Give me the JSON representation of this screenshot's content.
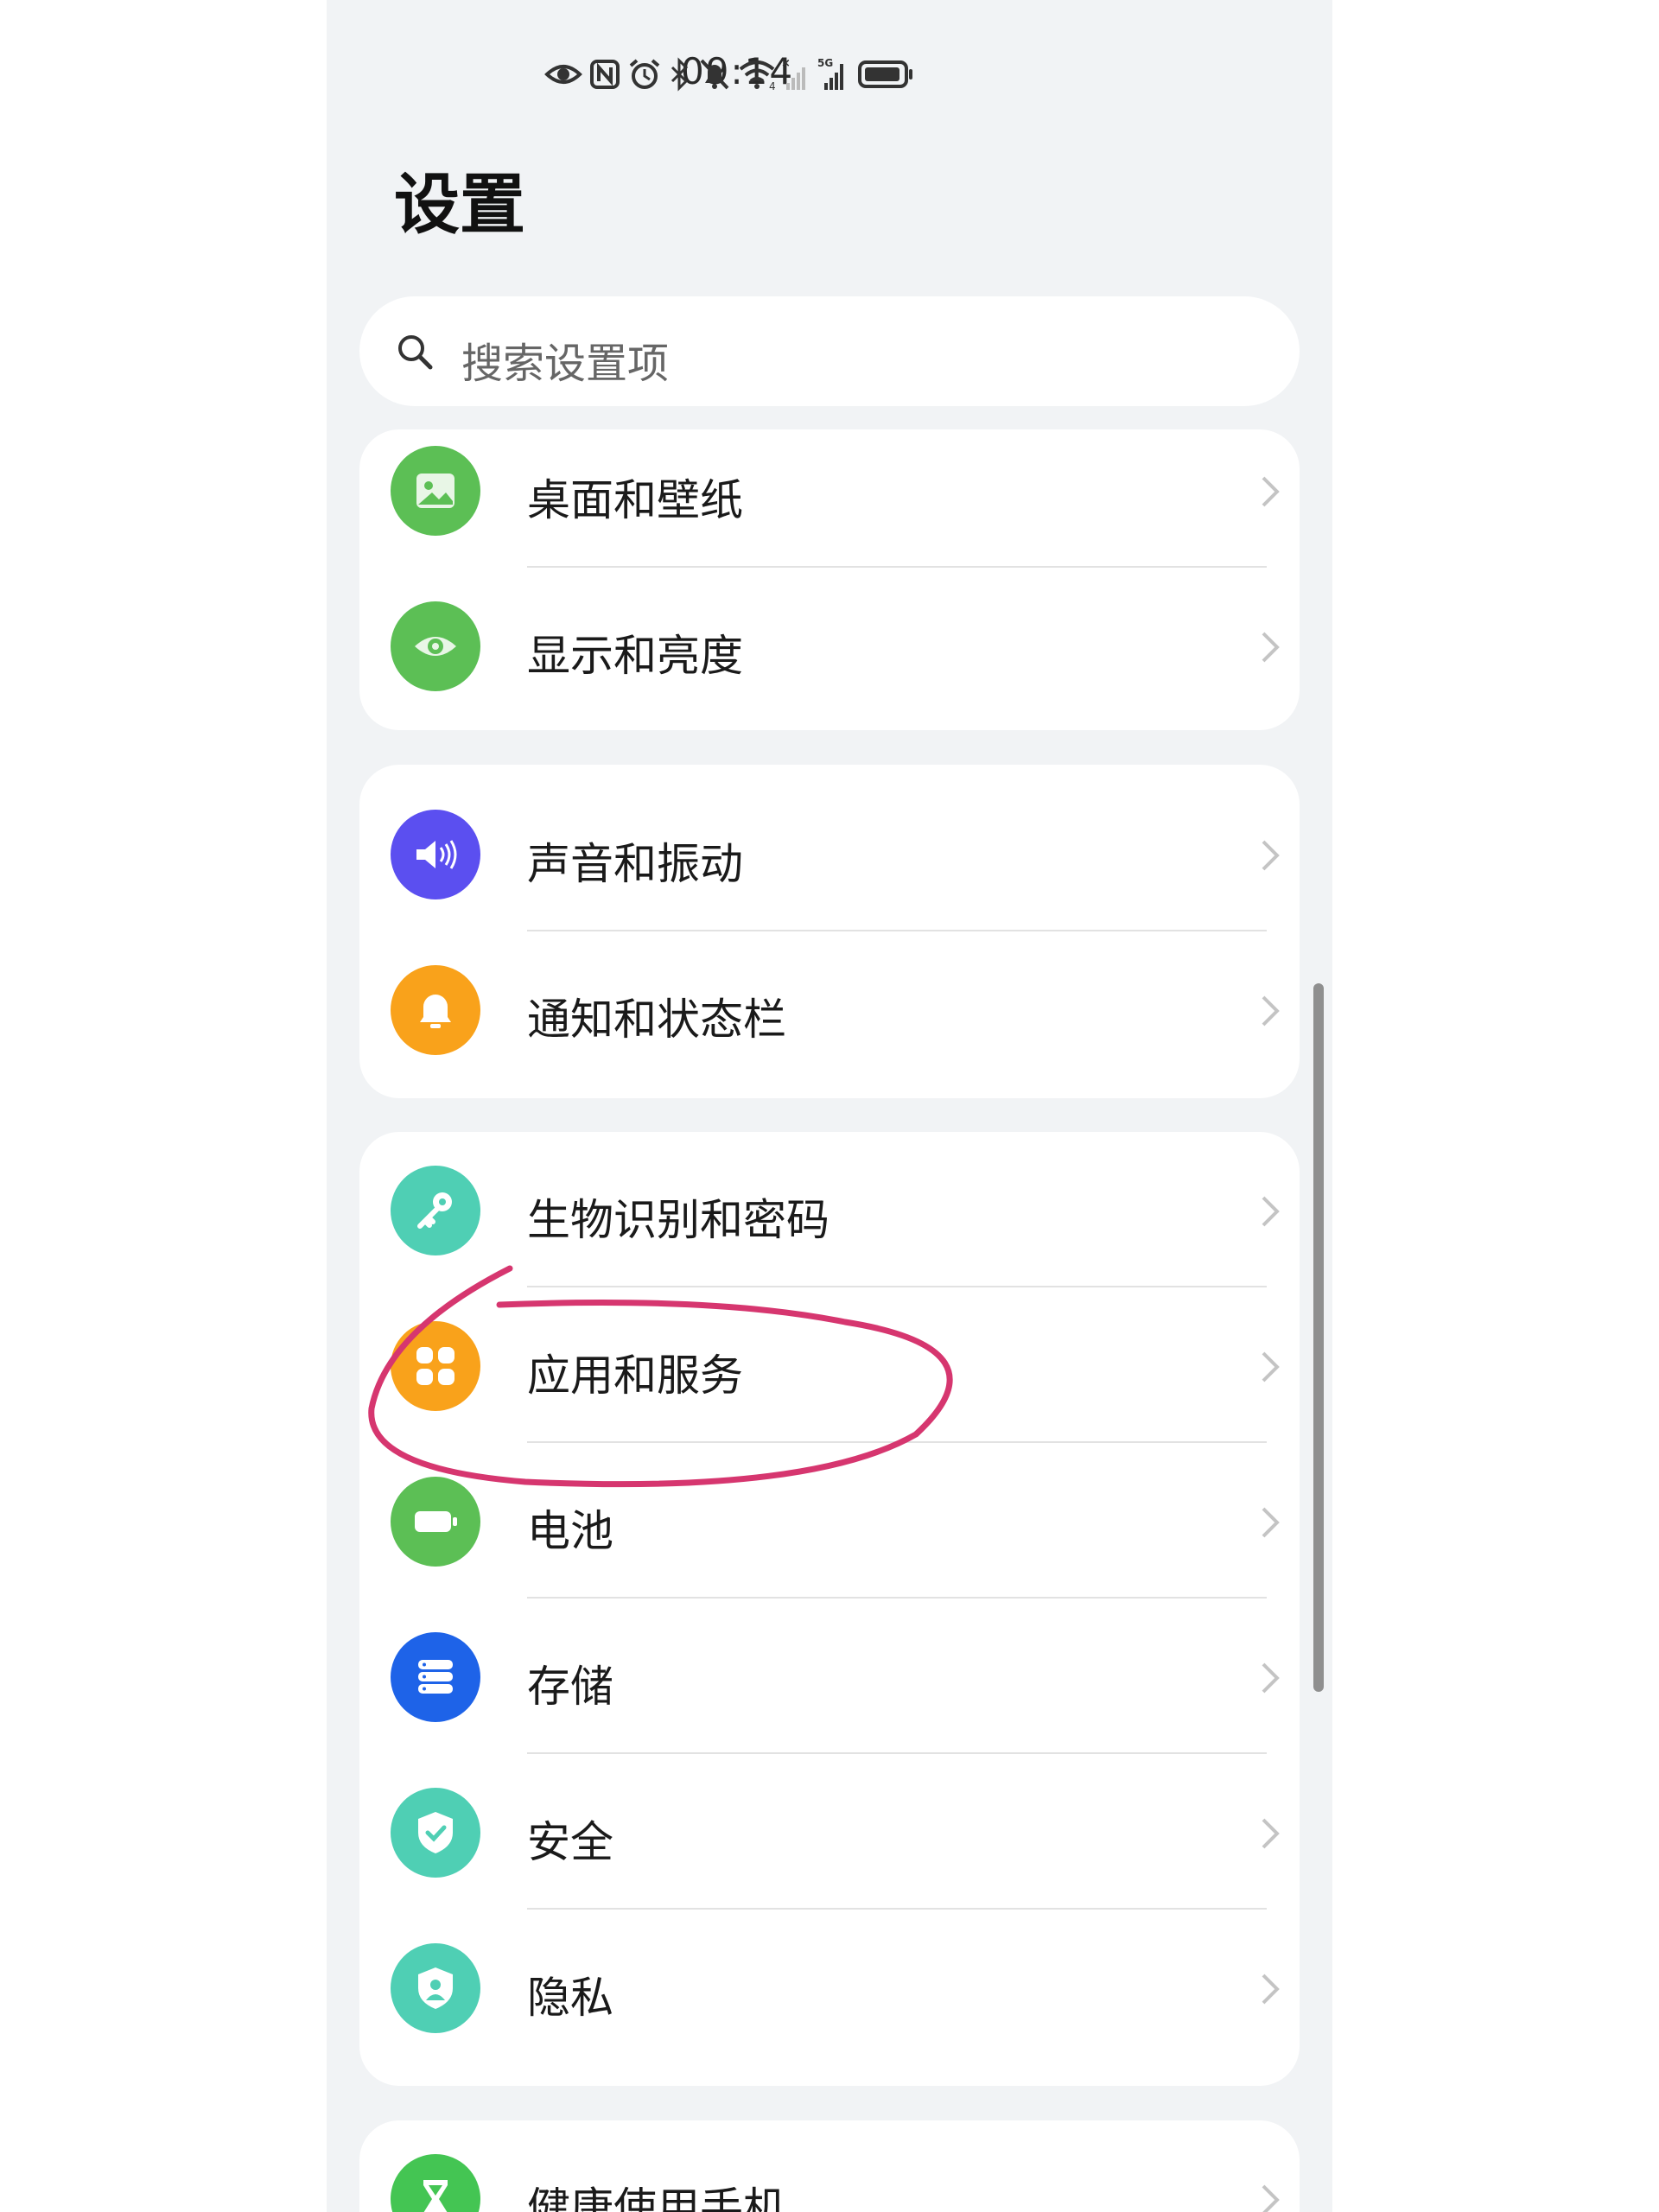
{
  "status_bar": {
    "time": "09:14",
    "icons": [
      "eye-icon",
      "nfc-icon",
      "alarm-icon",
      "bluetooth-icon",
      "mute-bell-icon",
      "wifi-icon",
      "sim1-signal-icon",
      "5g-signal-icon",
      "battery-icon"
    ]
  },
  "page": {
    "title": "设置"
  },
  "search": {
    "placeholder": "搜索设置项"
  },
  "groups": [
    {
      "items": [
        {
          "label": "桌面和壁纸",
          "icon": "wallpaper-icon",
          "color": "#5cbf55"
        },
        {
          "label": "显示和亮度",
          "icon": "eye-icon",
          "color": "#5cbf55"
        }
      ]
    },
    {
      "items": [
        {
          "label": "声音和振动",
          "icon": "speaker-icon",
          "color": "#5b4ff0"
        },
        {
          "label": "通知和状态栏",
          "icon": "bell-icon",
          "color": "#f9a21b"
        }
      ]
    },
    {
      "items": [
        {
          "label": "生物识别和密码",
          "icon": "key-icon",
          "color": "#4fcfb4"
        },
        {
          "label": "应用和服务",
          "icon": "apps-icon",
          "color": "#f9a21b"
        },
        {
          "label": "电池",
          "icon": "battery-icon",
          "color": "#5cbf55"
        },
        {
          "label": "存储",
          "icon": "storage-icon",
          "color": "#1e63e8"
        },
        {
          "label": "安全",
          "icon": "shield-check-icon",
          "color": "#4fcfb4"
        },
        {
          "label": "隐私",
          "icon": "privacy-icon",
          "color": "#4fcfb4"
        }
      ]
    },
    {
      "items": [
        {
          "label": "健康使用手机",
          "icon": "hourglass-icon",
          "color": "#44c553"
        }
      ]
    }
  ],
  "colors": {
    "background": "#f1f3f5",
    "card": "#ffffff",
    "annotation": "#d6366f"
  }
}
